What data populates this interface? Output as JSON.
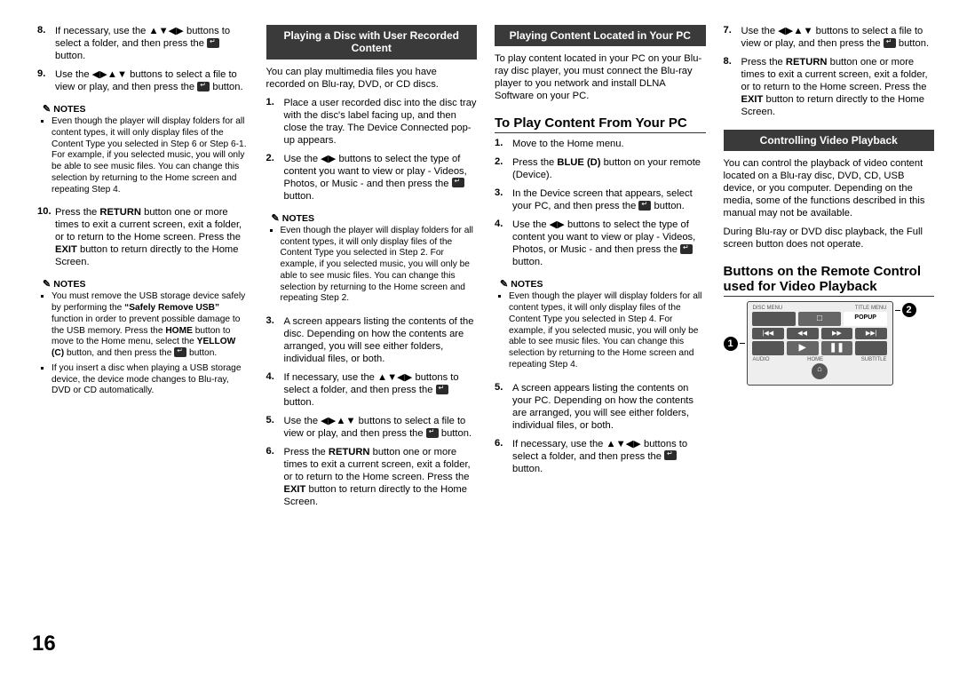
{
  "page_number": "16",
  "col1": {
    "i8": "If necessary, use the ▲▼◀▶ buttons to select a folder, and then press the ",
    "i8b": " button.",
    "i9": "Use the ◀▶▲▼ buttons to select a file to view or play, and then press the ",
    "i9b": " button.",
    "notes_label_a": "NOTES",
    "note_a1": "Even though the player will display folders for all content types, it will only display files of the Content Type you selected in Step 6 or Step 6-1.\nFor example, if you selected music, you will only be able to see music files. You can change this selection by returning to the Home screen and repeating Step 4.",
    "i10_a": "Press the ",
    "i10_ret": "RETURN",
    "i10_b": " button one or more times to exit a current screen, exit a folder, or to return to the Home screen. Press the ",
    "i10_exit": "EXIT",
    "i10_c": " button to return directly to the Home Screen.",
    "notes_label_b": "NOTES",
    "note_b1_a": "You must remove the USB storage device safely by performing the ",
    "note_b1_bold1": "“Safely Remove USB”",
    "note_b1_b": " function in order to prevent possible damage to the USB memory. Press the ",
    "note_b1_bold2": "HOME",
    "note_b1_c": " button to move to the Home menu, select the ",
    "note_b1_bold3": "YELLOW (C)",
    "note_b1_d": " button, and then press the ",
    "note_b1_e": " button.",
    "note_b2": "If you insert a disc when playing a USB storage device, the device mode changes to Blu-ray, DVD or CD automatically."
  },
  "col2": {
    "banner": "Playing a Disc with User Recorded Content",
    "lead": "You can play multimedia files you have recorded on Blu-ray, DVD, or CD discs.",
    "i1": "Place a user recorded disc into the disc tray with the disc's label facing up, and then close the tray. The Device Connected pop-up appears.",
    "i2a": "Use the ◀▶ buttons to select the type of content you want to view or play - Videos, Photos, or Music - and then press the ",
    "i2b": " button.",
    "notes_label": "NOTES",
    "note1": "Even though the player will display folders for all content types, it will only display files of the Content Type you selected in Step 2. For example, if you selected music, you will only be able to see music files. You can change this selection by returning to the Home screen and repeating Step 2.",
    "i3": "A screen appears listing the contents of the disc. Depending on how the contents are arranged, you will see either folders, individual files, or both.",
    "i4a": "If necessary, use the ▲▼◀▶ buttons to select a folder, and then press the ",
    "i4b": " button.",
    "i5a": "Use the ◀▶▲▼ buttons to select a file to view or play, and then press the ",
    "i5b": " button.",
    "i6a": "Press the ",
    "i6_ret": "RETURN",
    "i6b": " button one or more times to exit a current screen, exit a folder, or to return to the Home screen. Press the ",
    "i6_exit": "EXIT",
    "i6c": " button to return directly to the Home Screen."
  },
  "col3": {
    "banner": "Playing Content Located in Your PC",
    "lead": "To play content located in your PC on your Blu-ray disc player, you must connect the Blu-ray player to you network and install DLNA Software on your PC.",
    "h2": "To Play Content From Your PC",
    "i1": "Move to the Home menu.",
    "i2a": "Press the ",
    "i2_blue": "BLUE (D)",
    "i2b": " button on your remote (Device).",
    "i3a": "In the Device screen that appears, select your PC, and then press the ",
    "i3b": " button.",
    "i4a": "Use the ◀▶ buttons to select the type of content you want to view or play - Videos, Photos, or Music - and then press the ",
    "i4b": " button.",
    "notes_label": "NOTES",
    "note1": "Even though the player will display folders for all content types, it will only display files of the Content Type you selected in Step 4. For example, if you selected music, you will only be able to see music files. You can change this selection by returning to the Home screen and repeating Step 4.",
    "i5": "A screen appears listing the contents on your PC. Depending on how the contents are arranged, you will see either folders, individual files, or both.",
    "i6a": "If necessary, use the ▲▼◀▶ buttons to select a folder, and then press the ",
    "i6b": " button."
  },
  "col4": {
    "i7a": "Use the ◀▶▲▼ buttons to select a file to view or play, and then press the ",
    "i7b": " button.",
    "i8a": "Press the ",
    "i8_ret": "RETURN",
    "i8b": " button one or more times to exit a current screen, exit a folder, or to return to the Home screen. Press the ",
    "i8_exit": "EXIT",
    "i8c": " button to return directly to the Home Screen.",
    "banner": "Controlling Video Playback",
    "lead1": "You can control the playback of video content located on a Blu-ray disc, DVD, CD, USB device, or you computer. Depending on the media, some of the functions described in this manual may not be available.",
    "lead2": "During Blu-ray or DVD disc playback, the Full screen button does not operate.",
    "h2": "Buttons on the Remote Control used for Video Playback",
    "remote": {
      "lbl_discmenu": "DISC MENU",
      "lbl_titlemenu": "TITLE MENU",
      "btn_stop": "□",
      "btn_popup": "POPUP",
      "btn_prev": "|◀◀",
      "btn_rw": "◀◀",
      "btn_ff": "▶▶",
      "btn_next": "▶▶|",
      "btn_play": "▶",
      "btn_pause": "❚❚",
      "lbl_audio": "AUDIO",
      "lbl_home": "HOME",
      "lbl_subtitle": "SUBTITLE",
      "btn_home": "⌂",
      "callout1": "1",
      "callout2": "2"
    }
  }
}
